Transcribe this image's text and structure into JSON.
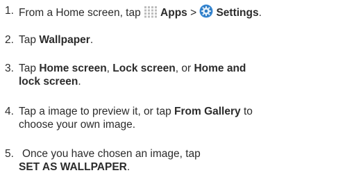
{
  "steps": [
    {
      "number": "1.",
      "before": "From a Home screen, tap ",
      "apps_label": "Apps",
      "separator": " > ",
      "settings_label": "Settings",
      "after": "."
    },
    {
      "number": "2.",
      "before": "Tap ",
      "bold": "Wallpaper",
      "after": "."
    },
    {
      "number": "3.",
      "before": "Tap ",
      "bold1": "Home screen",
      "mid1": ", ",
      "bold2": "Lock screen",
      "mid2": ", or ",
      "bold3a": "Home and",
      "bold3b": "lock screen",
      "after": "."
    },
    {
      "number": "4.",
      "line1_before": "Tap a image to preview it, or tap ",
      "bold": "From Gallery",
      "line1_after": " to",
      "line2": "choose your own image."
    },
    {
      "number": "5.",
      "line1": "Once you have chosen an image, tap",
      "bold": "SET AS WALLPAPER",
      "after": "."
    }
  ],
  "icons": {
    "apps": "apps-grid-icon",
    "settings": "settings-gear-icon"
  },
  "colors": {
    "text": "#2b2b2b",
    "apps_icon": "#bdbdbd",
    "settings_icon": "#2f80c8"
  }
}
